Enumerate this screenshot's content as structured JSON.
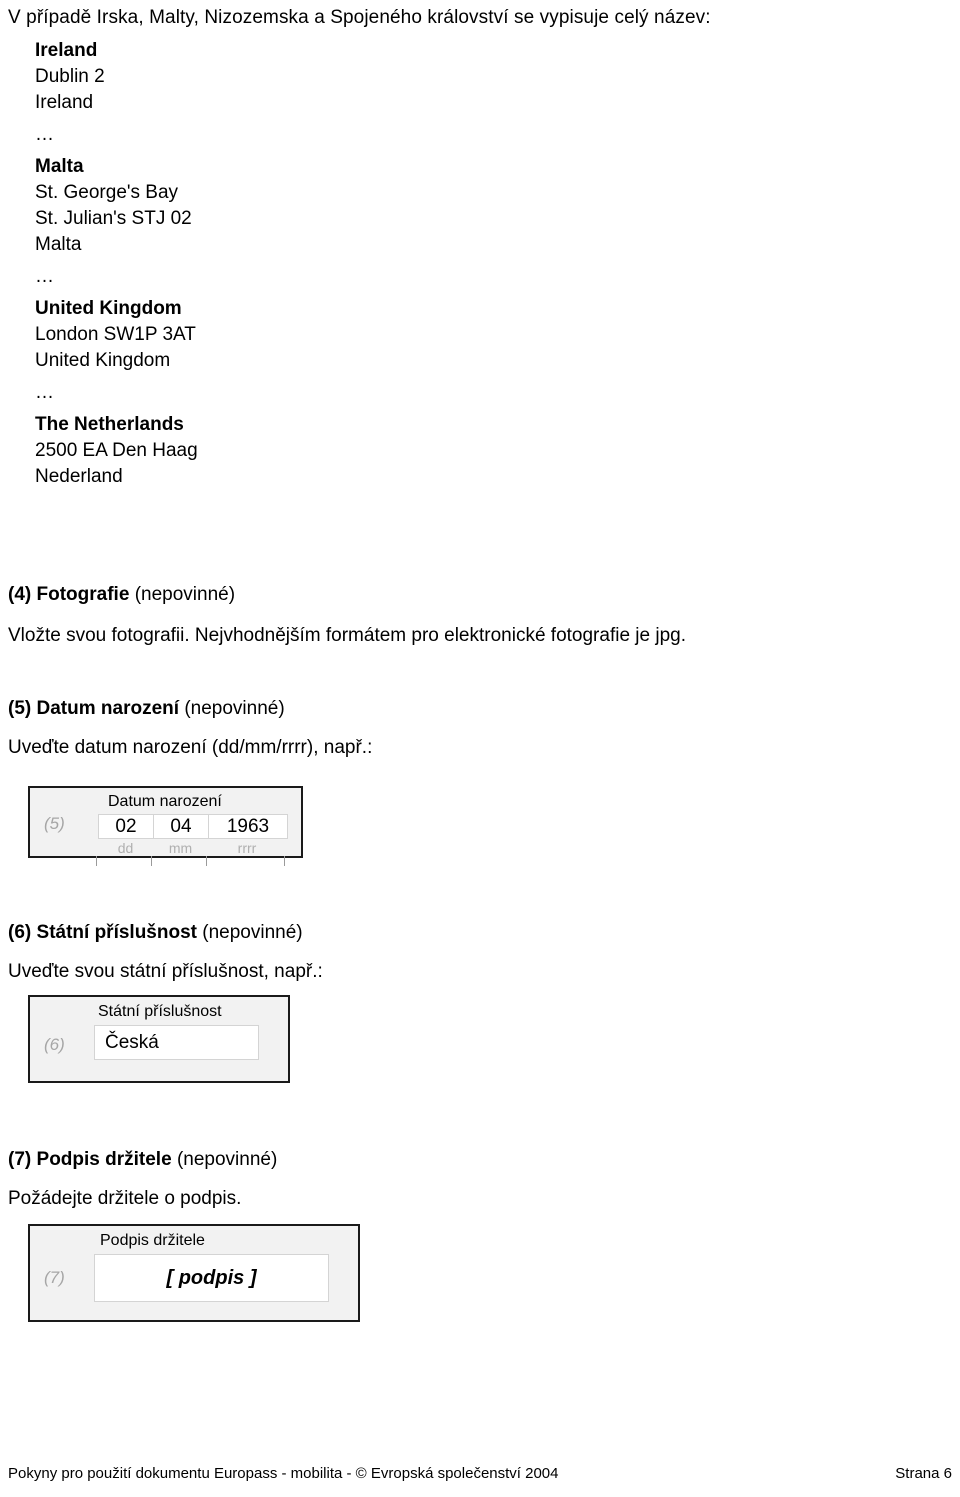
{
  "intro": {
    "text": "V případě Irska, Malty, Nizozemska a Spojeného království se vypisuje celý název:"
  },
  "addresses": [
    {
      "country": "Ireland",
      "lines": [
        "Dublin 2",
        "Ireland"
      ],
      "separator": "…"
    },
    {
      "country": "Malta",
      "lines": [
        "St. George's Bay",
        "St. Julian's STJ 02",
        "Malta"
      ],
      "separator": "…"
    },
    {
      "country": "United Kingdom",
      "lines": [
        "London SW1P 3AT",
        "United Kingdom"
      ],
      "separator": "…"
    },
    {
      "country": "The Netherlands",
      "lines": [
        "2500 EA Den Haag",
        "Nederland"
      ],
      "separator": ""
    }
  ],
  "sections": [
    {
      "number": "(4)",
      "title": "Fotografie",
      "optional": "(nepovinné)",
      "description": "Vložte svou fotografii. Nejvhodnějším formátem pro elektronické fotografie je jpg."
    },
    {
      "number": "(5)",
      "title": "Datum narození",
      "optional": "(nepovinné)",
      "description": "Uveďte datum narození (dd/mm/rrrr), např.:"
    },
    {
      "number": "(6)",
      "title": "Státní příslušnost",
      "optional": "(nepovinné)",
      "description": "Uveďte svou státní příslušnost, např.:"
    },
    {
      "number": "(7)",
      "title": "Podpis držitele",
      "optional": "(nepovinné)",
      "description": "Požádejte držitele o podpis."
    }
  ],
  "date_field": {
    "tag": "(5)",
    "caption": "Datum narození",
    "day": "02",
    "month": "04",
    "year": "1963",
    "hint_day": "dd",
    "hint_month": "mm",
    "hint_year": "rrrr"
  },
  "nationality_field": {
    "tag": "(6)",
    "caption": "Státní příslušnost",
    "value": "Česká"
  },
  "signature_field": {
    "tag": "(7)",
    "caption": "Podpis držitele",
    "value": "[ podpis ]"
  },
  "footer": {
    "left": "Pokyny pro použití dokumentu Europass - mobilita  -  © Evropská společenství 2004",
    "right": "Strana 6"
  },
  "colors": {
    "box_fill": "#f2f2f2",
    "box_border": "#1a1a1a",
    "input_border": "#d4d4d4",
    "tag_gray": "#a6a6a6",
    "hint_gray": "#b0b0b0"
  }
}
